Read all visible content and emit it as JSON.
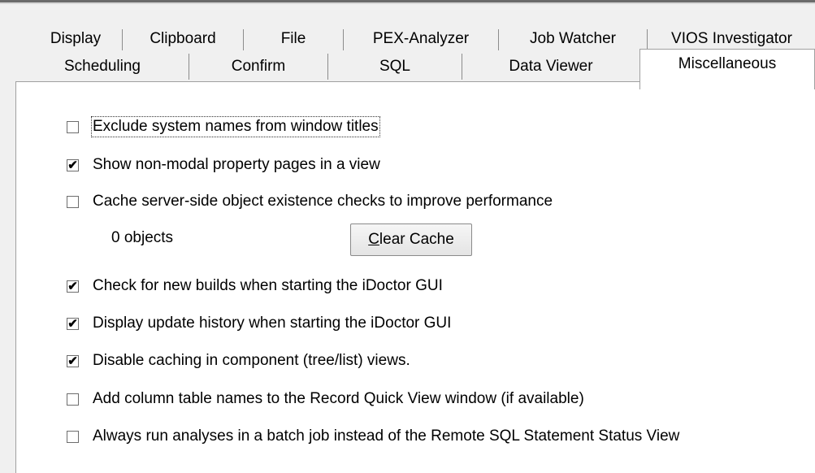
{
  "tabs_row1": [
    "Display",
    "Clipboard",
    "File",
    "PEX-Analyzer",
    "Job Watcher",
    "VIOS Investigator"
  ],
  "tabs_row2": [
    "Scheduling",
    "Confirm",
    "SQL",
    "Data Viewer",
    "Miscellaneous"
  ],
  "active_tab": "Miscellaneous",
  "options": [
    {
      "label": "Exclude system names from window titles",
      "checked": false
    },
    {
      "label": "Show non-modal property pages in a view",
      "checked": true
    },
    {
      "label": "Cache server-side object existence checks to improve performance",
      "checked": false
    },
    {
      "label": "Check for new builds when starting the iDoctor GUI",
      "checked": true
    },
    {
      "label": "Display update history when starting the iDoctor GUI",
      "checked": true
    },
    {
      "label": "Disable caching in component (tree/list) views.",
      "checked": true
    },
    {
      "label": "Add column table names to the Record Quick View window (if available)",
      "checked": false
    },
    {
      "label": "Always run analyses in a batch job instead of the Remote SQL Statement Status View",
      "checked": false
    }
  ],
  "cache": {
    "object_count": "0 objects",
    "clear_mnemonic": "C",
    "clear_rest": "lear Cache"
  }
}
